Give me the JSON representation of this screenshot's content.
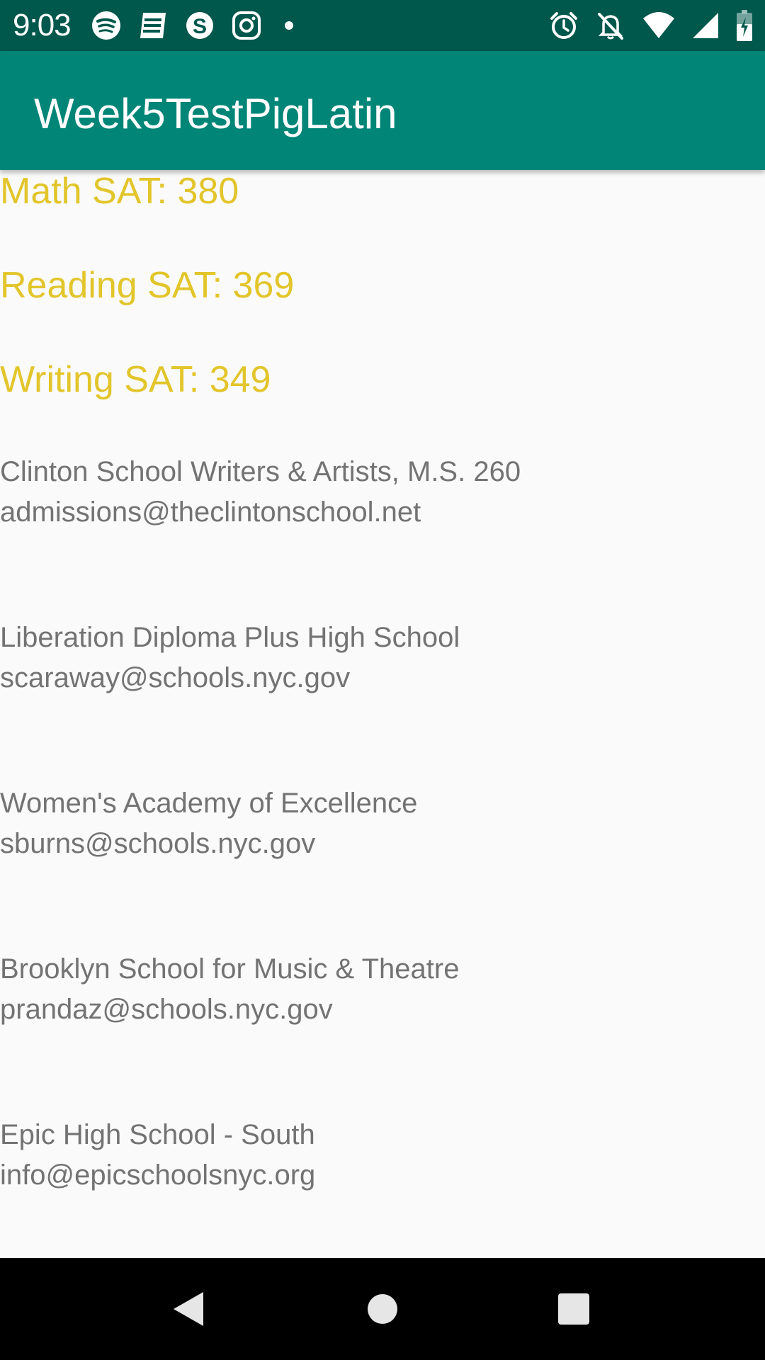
{
  "status_bar": {
    "time": "9:03",
    "left_icons": [
      "spotify-icon",
      "news-icon",
      "skype-icon",
      "instagram-icon",
      "notification-dot-icon"
    ],
    "right_icons": [
      "alarm-icon",
      "notifications-off-icon",
      "wifi-icon",
      "signal-icon",
      "battery-charging-icon"
    ]
  },
  "app_bar": {
    "title": "Week5TestPigLatin"
  },
  "sat_scores": {
    "math": "Math SAT: 380",
    "reading": "Reading SAT: 369",
    "writing": "Writing SAT: 349"
  },
  "schools": [
    {
      "name": "Clinton School Writers & Artists, M.S. 260",
      "email": "admissions@theclintonschool.net"
    },
    {
      "name": "Liberation Diploma Plus High School",
      "email": "scaraway@schools.nyc.gov"
    },
    {
      "name": "Women's Academy of Excellence",
      "email": "sburns@schools.nyc.gov"
    },
    {
      "name": "Brooklyn School for Music & Theatre",
      "email": "prandaz@schools.nyc.gov"
    },
    {
      "name": "Epic High School - South",
      "email": "info@epicschoolsnyc.org"
    }
  ],
  "nav_bar": {
    "buttons": [
      "back-icon",
      "home-icon",
      "recents-icon"
    ]
  },
  "colors": {
    "status_bar": "#00574b",
    "app_bar": "#008577",
    "sat_text": "#e2c52a",
    "school_text": "#737373",
    "background": "#fafafa"
  }
}
